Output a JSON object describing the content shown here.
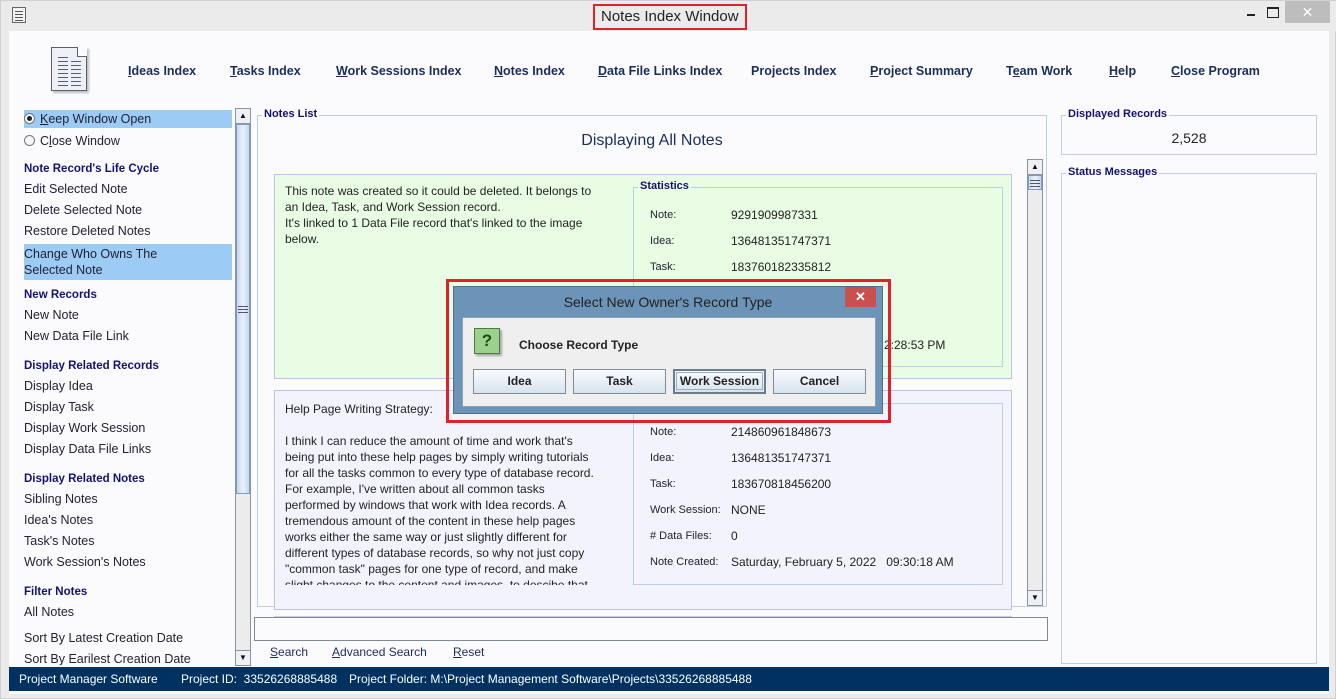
{
  "window": {
    "title": "Notes Index Window",
    "controls": {
      "minimize": "minimize",
      "maximize": "maximize",
      "close": "✕"
    }
  },
  "topnav": {
    "items": [
      {
        "mnemonic": "I",
        "rest": "deas Index"
      },
      {
        "mnemonic": "T",
        "rest": "asks Index"
      },
      {
        "mnemonic": "W",
        "rest": "ork Sessions Index"
      },
      {
        "mnemonic": "N",
        "rest": "otes Index"
      },
      {
        "mnemonic": "D",
        "rest": "ata File Links Index"
      },
      {
        "mnemonic": "",
        "rest": "Projects Index"
      },
      {
        "mnemonic": "P",
        "rest": "roject Summary"
      },
      {
        "pre": "T",
        "mnemonic": "e",
        "rest": "am Work"
      },
      {
        "mnemonic": "H",
        "rest": "elp"
      },
      {
        "mnemonic": "C",
        "rest": "lose Program"
      }
    ]
  },
  "sidebar": {
    "radio_keep": {
      "mnemonic": "K",
      "rest": "eep Window Open",
      "checked": true
    },
    "radio_close": {
      "pre": "C",
      "mnemonic": "l",
      "rest": "ose Window",
      "checked": false
    },
    "life_cycle_head": "Note Record's Life Cycle",
    "edit_note": "Edit Selected Note",
    "delete_note": "Delete Selected Note",
    "restore_notes": "Restore Deleted Notes",
    "change_owner_1": "Change Who Owns The",
    "change_owner_2": "Selected Note",
    "new_records_head": "New Records",
    "new_note": "New Note",
    "new_link": "New Data File Link",
    "related_records_head": "Display Related Records",
    "display_idea": "Display Idea",
    "display_task": "Display Task",
    "display_ws": "Display Work Session",
    "display_links": "Display Data File Links",
    "related_notes_head": "Display Related Notes",
    "sibling_notes": "Sibling Notes",
    "idea_notes": "Idea's Notes",
    "task_notes": "Task's Notes",
    "ws_notes": "Work Session's Notes",
    "filter_head": "Filter Notes",
    "all_notes": "All Notes",
    "sort_latest": "Sort By Latest Creation Date",
    "sort_earliest": "Sort By Earilest Creation Date"
  },
  "notes_list": {
    "group_title": "Notes List",
    "heading": "Displaying All Notes",
    "notes": [
      {
        "text_lines": [
          "This note was created so it could be deleted. It belongs to",
          "an Idea, Task, and Work Session record.",
          "It's linked to 1 Data File record that's linked to the image",
          "below."
        ],
        "stats_title": "Statistics",
        "stats": [
          {
            "label": "Note:",
            "value": "9291909987331"
          },
          {
            "label": "Idea:",
            "value": "136481351747371"
          },
          {
            "label": "Task:",
            "value": "183760182335812"
          }
        ],
        "partial_time": "2:28:53 PM",
        "background": "#e9fde5"
      },
      {
        "title": "Help Page Writing Strategy:",
        "text_lines": [
          "I think I can reduce the amount of time and work that's",
          "being put into these help pages by simply writing tutorials",
          "for all the tasks common to every type of database record.",
          "For example, I've written about all common tasks",
          "performed by windows that work with Idea records. A",
          "tremendous amount of the content in these help pages",
          "works either the same way or just slightly different for",
          "different types of database records, so why not just copy",
          "\"common task\" pages for one type of record, and make",
          "slight changes to the content and images, to descibe that"
        ],
        "stats": [
          {
            "label": "Note:",
            "value": "214860961848673"
          },
          {
            "label": "Idea:",
            "value": "136481351747371"
          },
          {
            "label": "Task:",
            "value": "183670818456200"
          },
          {
            "label": "Work Session:",
            "value": "NONE"
          },
          {
            "label": "# Data Files:",
            "value": "0"
          },
          {
            "label": "Note Created:",
            "value": "Saturday, February 5, 2022   09:30:18 AM"
          }
        ],
        "background": "#f3f3fd"
      }
    ]
  },
  "search": {
    "input_value": "",
    "search_label": {
      "mnemonic": "S",
      "rest": "earch"
    },
    "advanced_label": {
      "mnemonic": "A",
      "rest": "dvanced Search"
    },
    "reset_label": {
      "mnemonic": "R",
      "rest": "eset"
    }
  },
  "right_panel": {
    "displayed_records_title": "Displayed Records",
    "displayed_records_value": "2,528",
    "status_messages_title": "Status Messages",
    "status_messages": ""
  },
  "statusbar": {
    "app": "Project Manager Software",
    "project_id": "Project ID:  33526268885488",
    "project_folder": "Project Folder: M:\\Project Management Software\\Projects\\33526268885488"
  },
  "dialog": {
    "title": "Select New Owner's Record Type",
    "close": "✕",
    "icon": "?",
    "message": "Choose Record Type",
    "buttons": [
      "Idea",
      "Task",
      "Work Session",
      "Cancel"
    ],
    "focused_button": "Work Session"
  },
  "colors": {
    "accent_nav": "#1a2e5a",
    "statusbar_bg": "#003261",
    "selection": "#9ccbf6",
    "highlight_red": "#e0202a"
  }
}
